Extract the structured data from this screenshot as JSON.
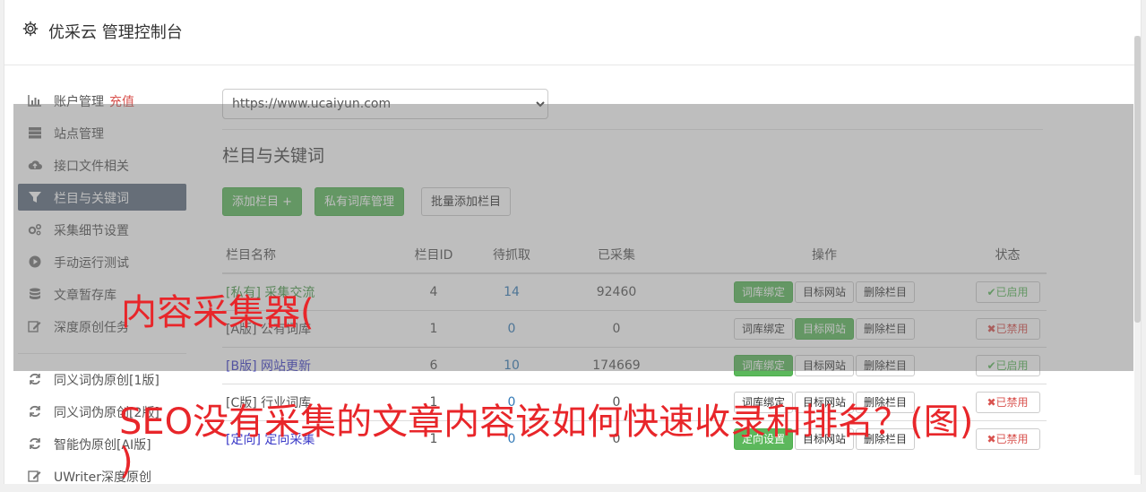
{
  "header": {
    "title": "优采云 管理控制台"
  },
  "sidebar": {
    "items": [
      {
        "label": "账户管理",
        "extra": "充值",
        "icon": "bar-chart-icon"
      },
      {
        "label": "站点管理",
        "icon": "server-icon"
      },
      {
        "label": "接口文件相关",
        "icon": "cloud-upload-icon"
      },
      {
        "label": "栏目与关键词",
        "icon": "filter-icon",
        "active": true
      },
      {
        "label": "采集细节设置",
        "icon": "cogs-icon"
      },
      {
        "label": "手动运行测试",
        "icon": "play-circle-icon"
      },
      {
        "label": "文章暂存库",
        "icon": "database-icon"
      },
      {
        "label": "深度原创任务",
        "icon": "edit-icon"
      }
    ],
    "items2": [
      {
        "label": "同义词伪原创[1版]",
        "icon": "refresh-icon"
      },
      {
        "label": "同义词伪原创[2版]",
        "icon": "refresh-icon"
      },
      {
        "label": "智能伪原创[AI版]",
        "icon": "refresh-icon"
      },
      {
        "label": "UWriter深度原创",
        "icon": "edit-icon"
      }
    ]
  },
  "main": {
    "site_select": "https://www.ucaiyun.com",
    "section_title": "栏目与关键词",
    "buttons": {
      "add": "添加栏目 +",
      "private": "私有词库管理",
      "batch": "批量添加栏目"
    },
    "table": {
      "headers": [
        "栏目名称",
        "栏目ID",
        "待抓取",
        "已采集",
        "操作",
        "状态"
      ],
      "rows": [
        {
          "name": "[私有] 采集交流",
          "id": "4",
          "pending": "14",
          "collected": "92460",
          "a1": "词库绑定",
          "a2": "目标网站",
          "a3": "删除栏目",
          "status": "✔已启用"
        },
        {
          "name": "[A版] 公有词库",
          "id": "1",
          "pending": "0",
          "collected": "0",
          "a1": "词库绑定",
          "a2": "目标网站",
          "a3": "删除栏目",
          "status": "✖已禁用"
        },
        {
          "name": "[B版] 网站更新",
          "id": "6",
          "pending": "10",
          "collected": "174669",
          "a1": "词库绑定",
          "a2": "目标网站",
          "a3": "删除栏目",
          "status": "✔已启用"
        },
        {
          "name": "[C版] 行业词库",
          "id": "1",
          "pending": "0",
          "collected": "0",
          "a1": "词库绑定",
          "a2": "目标网站",
          "a3": "删除栏目",
          "status": "✖已禁用"
        },
        {
          "name": "[定向] 定向采集",
          "id": "1",
          "pending": "0",
          "collected": "0",
          "a1": "定向设置",
          "a2": "目标网站",
          "a3": "删除栏目",
          "status": "✖已禁用"
        }
      ]
    }
  },
  "watermark": {
    "line1": "内容采集器(",
    "line2": "SEO没有采集的文章内容该如何快速收录和排名？(图)",
    "line3": ")"
  },
  "colors": {
    "green": "#5cb85c",
    "red": "#d9534f",
    "blue": "#337ab7",
    "active_nav": "#606e80",
    "watermark": "#e8262a"
  }
}
